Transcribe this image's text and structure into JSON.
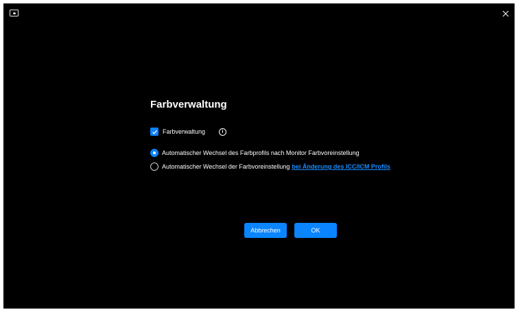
{
  "window": {
    "app_icon": "monitor-icon",
    "close_icon": "close-icon"
  },
  "dialog": {
    "title": "Farbverwaltung",
    "checkbox": {
      "label": "Farbverwaltung",
      "checked": true,
      "info_icon": "info-icon"
    },
    "options": [
      {
        "label": "Automatischer Wechsel des Farbprofils nach Monitor Farbvoreinstellung",
        "selected": true
      },
      {
        "label": "Automatischer Wechsel der Farbvoreinstellung",
        "link": "bei Änderung des ICC/ICM Profils",
        "selected": false
      }
    ],
    "buttons": {
      "cancel": "Abbrechen",
      "ok": "OK"
    }
  },
  "colors": {
    "background": "#000000",
    "accent": "#0a84ff",
    "link": "#1a8cff",
    "text": "#ffffff"
  }
}
